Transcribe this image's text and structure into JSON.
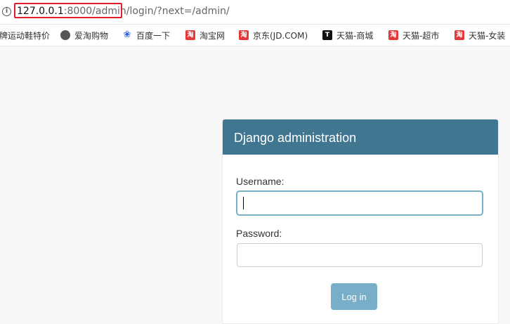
{
  "browser": {
    "url_host": "127.0.0.1",
    "url_port": ":8000",
    "url_path_highlighted": "/admin/",
    "url_rest": "login/?next=/admin/"
  },
  "bookmarks": [
    {
      "label": "牌运动鞋特价",
      "icon": "none"
    },
    {
      "label": "爱淘购物",
      "icon": "globe-icon"
    },
    {
      "label": "百度一下",
      "icon": "baidu-paw-icon"
    },
    {
      "label": "淘宝网",
      "icon": "taobao-icon"
    },
    {
      "label": "京东(JD.COM)",
      "icon": "taobao-icon"
    },
    {
      "label": "天猫-商城",
      "icon": "tmall-icon"
    },
    {
      "label": "天猫-超市",
      "icon": "taobao-icon"
    },
    {
      "label": "天猫-女装",
      "icon": "taobao-icon"
    }
  ],
  "login": {
    "title": "Django administration",
    "username_label": "Username:",
    "username_value": "",
    "password_label": "Password:",
    "password_value": "",
    "submit_label": "Log in"
  },
  "colors": {
    "header_bg": "#417690",
    "button_bg": "#79aec8",
    "highlight_border": "#e11f2c"
  }
}
